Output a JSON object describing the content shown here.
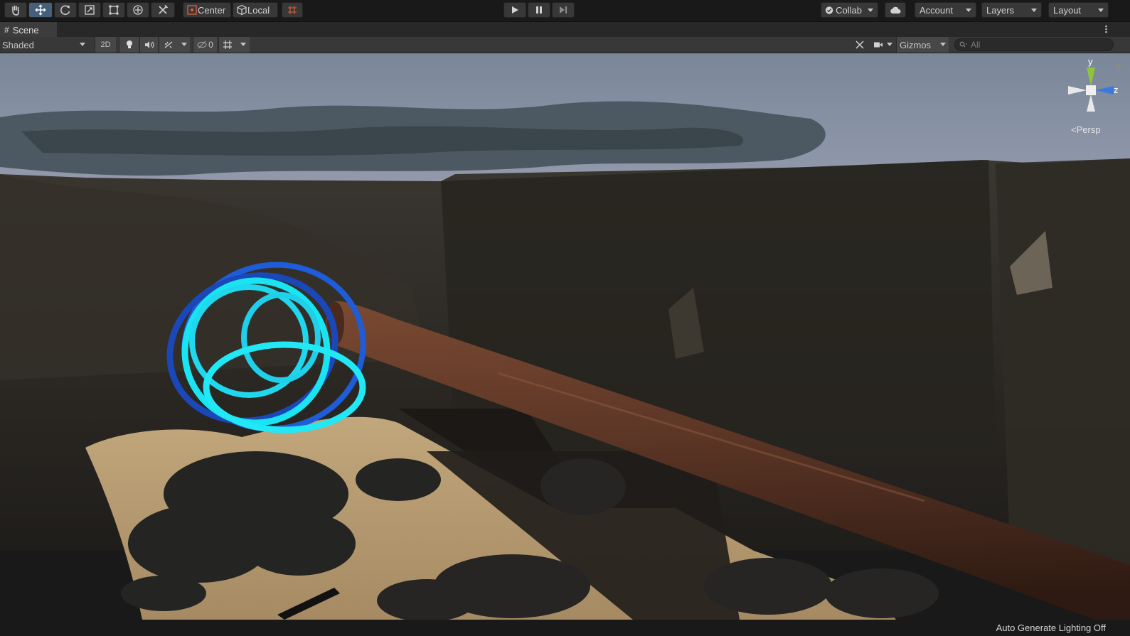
{
  "toolbar": {
    "tools": [
      "hand-tool-icon",
      "move-tool-icon",
      "rotate-tool-icon",
      "scale-tool-icon",
      "rect-tool-icon",
      "transform-tool-icon",
      "custom-tool-icon"
    ],
    "pivot_mode": "Center",
    "pivot_rotation": "Local",
    "play_controls": [
      "play-icon",
      "pause-icon",
      "step-icon"
    ],
    "collab": "Collab",
    "account": "Account",
    "layers": "Layers",
    "layout": "Layout"
  },
  "scene_tab": {
    "title": "Scene"
  },
  "scene_toolbar": {
    "draw_mode": "Shaded",
    "mode_2d": "2D",
    "hidden_count": "0",
    "gizmos": "Gizmos",
    "search_placeholder": "All"
  },
  "orientation_gizmo": {
    "y_label": "y",
    "z_label": "z",
    "projection": "<Persp"
  },
  "status_bar": {
    "message": "Auto Generate Lighting Off"
  },
  "colors": {
    "accent_active": "#46607c",
    "ring_inner": "#18e0f0",
    "ring_outer": "#1450c8",
    "sand": "#b59b72",
    "log": "#5a3424",
    "cliff": "#2a2722",
    "sky": "#8a94a6"
  }
}
